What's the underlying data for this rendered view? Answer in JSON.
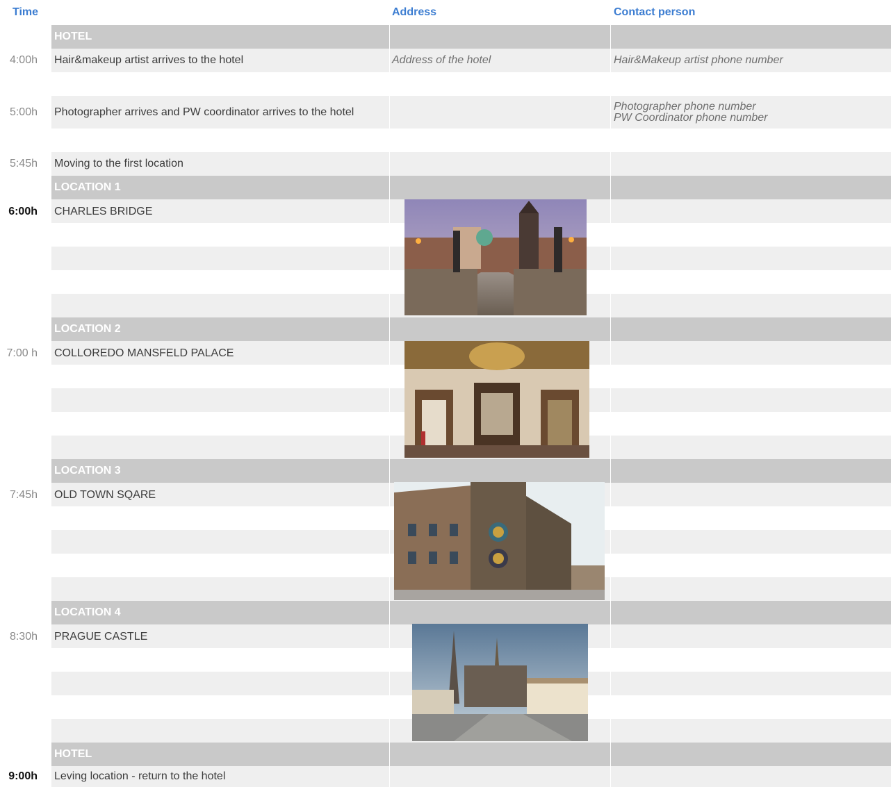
{
  "header": {
    "time": "Time",
    "address": "Address",
    "contact": "Contact person"
  },
  "hotel_section_1": "HOTEL",
  "rows": {
    "hair": {
      "time": "4:00h",
      "desc": "Hair&makeup artist arrives to the hotel",
      "address": "Address of the hotel",
      "contact": "Hair&Makeup artist phone number"
    },
    "photo": {
      "time": "5:00h",
      "desc": "Photographer arrives and PW coordinator arrives to the hotel",
      "contact_1": "Photographer phone number",
      "contact_2": "PW Coordinator phone number"
    },
    "moving": {
      "time": "5:45h",
      "desc": "Moving to the first location"
    }
  },
  "locations": [
    {
      "section": "LOCATION 1",
      "time": "6:00h",
      "name": "CHARLES BRIDGE",
      "image": "Charles Bridge photo"
    },
    {
      "section": "LOCATION 2",
      "time": "7:00 h",
      "name": "COLLOREDO MANSFELD PALACE",
      "image": "Colloredo Mansfeld Palace photo"
    },
    {
      "section": "LOCATION 3",
      "time": "7:45h",
      "name": "OLD TOWN SQARE",
      "image": "Old Town Square photo"
    },
    {
      "section": "LOCATION 4",
      "time": "8:30h",
      "name": "PRAGUE CASTLE",
      "image": "Prague Castle photo"
    }
  ],
  "hotel_section_2": "HOTEL",
  "final": {
    "time": "9:00h",
    "desc": "Leving location - return to the hotel"
  },
  "colors": {
    "header_text": "#3c7dd1",
    "section_band": "#c9c9c9",
    "alt_band": "#efefef",
    "time_text": "#8a8a8a"
  }
}
